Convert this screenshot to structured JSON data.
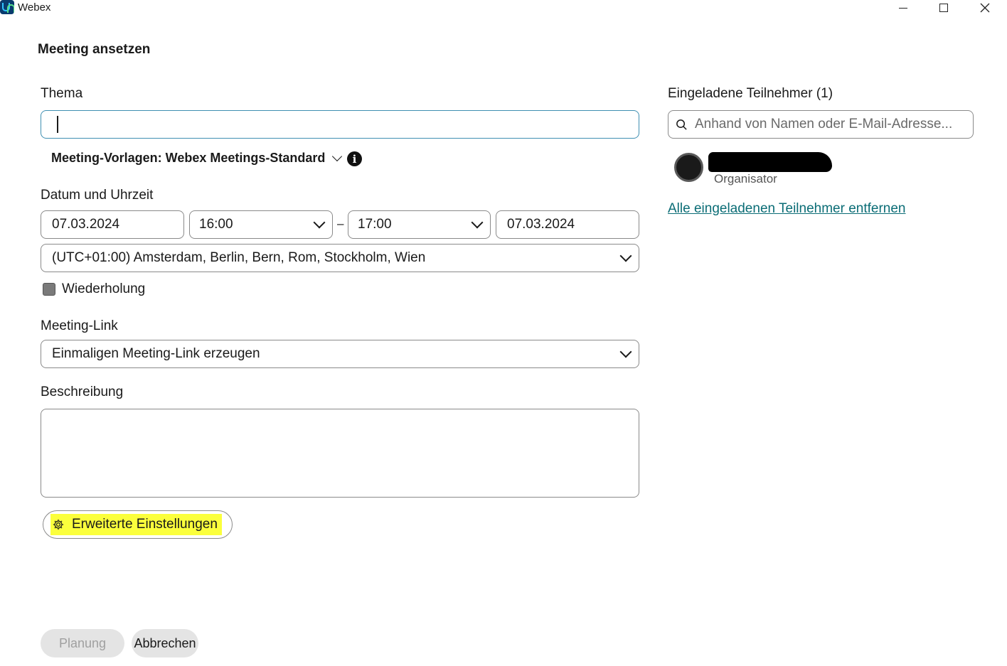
{
  "window": {
    "app_name": "Webex"
  },
  "dialog": {
    "title": "Meeting ansetzen"
  },
  "topic": {
    "label": "Thema",
    "value": ""
  },
  "template": {
    "text": "Meeting-Vorlagen: Webex Meetings-Standard"
  },
  "datetime": {
    "label": "Datum und Uhrzeit",
    "start_date": "07.03.2024",
    "start_time": "16:00",
    "separator": "–",
    "end_time": "17:00",
    "end_date": "07.03.2024",
    "timezone": "(UTC+01:00) Amsterdam, Berlin, Bern, Rom, Stockholm, Wien"
  },
  "recurrence": {
    "label": "Wiederholung",
    "checked": false
  },
  "meeting_link": {
    "label": "Meeting-Link",
    "value": "Einmaligen Meeting-Link erzeugen"
  },
  "description": {
    "label": "Beschreibung",
    "value": ""
  },
  "advanced": {
    "label": "Erweiterte Einstellungen"
  },
  "actions": {
    "schedule": "Planung",
    "cancel": "Abbrechen"
  },
  "invitees": {
    "label": "Eingeladene Teilnehmer (1)",
    "search_placeholder": "Anhand von Namen oder E-Mail-Adresse...",
    "organizer_role": "Organisator",
    "remove_all": "Alle eingeladenen Teilnehmer entfernen"
  },
  "colors": {
    "focus": "#3f8fb2",
    "link": "#0b6d76",
    "highlight": "#fbff3c"
  }
}
